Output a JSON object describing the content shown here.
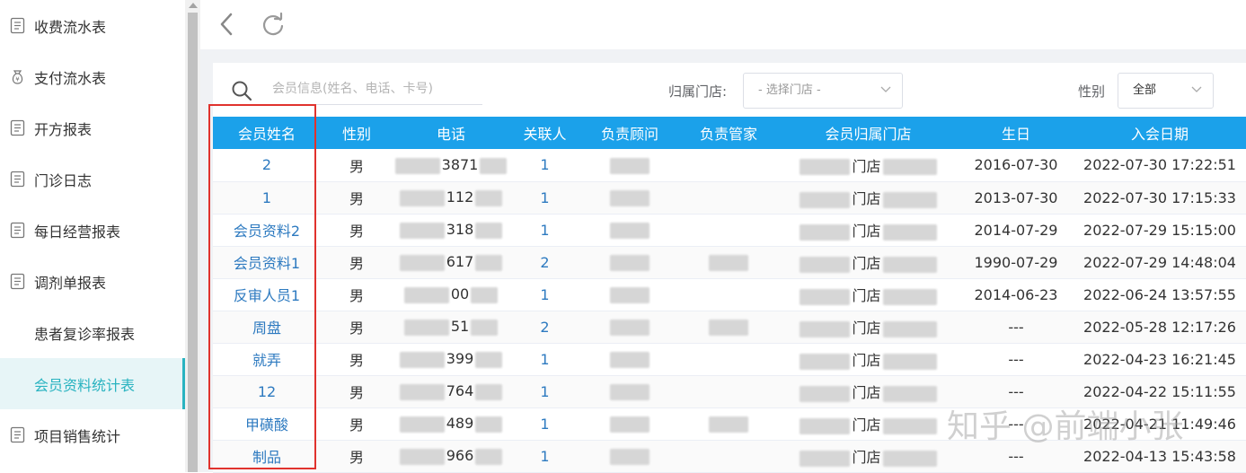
{
  "sidebar": {
    "items": [
      {
        "label": "收费流水表",
        "icon": "report-icon"
      },
      {
        "label": "支付流水表",
        "icon": "money-bag-icon"
      },
      {
        "label": "开方报表",
        "icon": "report-icon"
      },
      {
        "label": "门诊日志",
        "icon": "report-icon"
      },
      {
        "label": "每日经营报表",
        "icon": "report-icon"
      },
      {
        "label": "调剂单报表",
        "icon": "report-icon"
      },
      {
        "label": "患者复诊率报表",
        "icon": ""
      },
      {
        "label": "会员资料统计表",
        "icon": "",
        "active": true
      },
      {
        "label": "项目销售统计",
        "icon": "report-icon"
      }
    ]
  },
  "toolbar": {
    "back_icon": "chevron-left-icon",
    "refresh_icon": "refresh-icon"
  },
  "filters": {
    "search_placeholder": "会员信息(姓名、电话、卡号)",
    "store_label": "归属门店:",
    "store_placeholder": "- 选择门店 -",
    "gender_label": "性别",
    "gender_value": "全部"
  },
  "table": {
    "headers": [
      "会员姓名",
      "性别",
      "电话",
      "关联人",
      "负责顾问",
      "负责管家",
      "会员归属门店",
      "生日",
      "入会日期"
    ],
    "rows": [
      {
        "name": "2",
        "gender": "男",
        "phone": "3871",
        "linked": "1",
        "store": "门店",
        "birthday": "2016-07-30",
        "join_date": "2022-07-30 17:22:51"
      },
      {
        "name": "1",
        "gender": "男",
        "phone": "112",
        "linked": "1",
        "store": "门店",
        "birthday": "2013-07-30",
        "join_date": "2022-07-30 17:15:33"
      },
      {
        "name": "会员资料2",
        "gender": "男",
        "phone": "318",
        "linked": "1",
        "store": "门店",
        "birthday": "2014-07-29",
        "join_date": "2022-07-29 15:15:00"
      },
      {
        "name": "会员资料1",
        "gender": "男",
        "phone": "617",
        "linked": "2",
        "store": "门店",
        "birthday": "1990-07-29",
        "join_date": "2022-07-29 14:48:04"
      },
      {
        "name": "反审人员1",
        "gender": "男",
        "phone": "00",
        "linked": "1",
        "store": "门店",
        "birthday": "2014-06-23",
        "join_date": "2022-06-24 13:57:55"
      },
      {
        "name": "周盘",
        "gender": "男",
        "phone": "51",
        "linked": "2",
        "store": "门店",
        "birthday": "---",
        "join_date": "2022-05-28 12:17:26"
      },
      {
        "name": "就弄",
        "gender": "男",
        "phone": "399",
        "linked": "1",
        "store": "门店",
        "birthday": "---",
        "join_date": "2022-04-23 16:21:45"
      },
      {
        "name": "12",
        "gender": "男",
        "phone": "764",
        "linked": "1",
        "store": "门店",
        "birthday": "---",
        "join_date": "2022-04-22 15:11:55"
      },
      {
        "name": "甲磺酸",
        "gender": "男",
        "phone": "489",
        "linked": "1",
        "store": "门店",
        "birthday": "---",
        "join_date": "2022-04-21 11:49:46"
      },
      {
        "name": "制品",
        "gender": "男",
        "phone": "966",
        "linked": "1",
        "store": "门店",
        "birthday": "---",
        "join_date": "2022-04-13 15:43:58"
      }
    ]
  },
  "watermark": "知乎 @前端小张",
  "colors": {
    "header_bg": "#1ba1ea",
    "link": "#2d7ac0",
    "active_menu": "#29b3c0",
    "highlight_frame": "#e0322d"
  }
}
